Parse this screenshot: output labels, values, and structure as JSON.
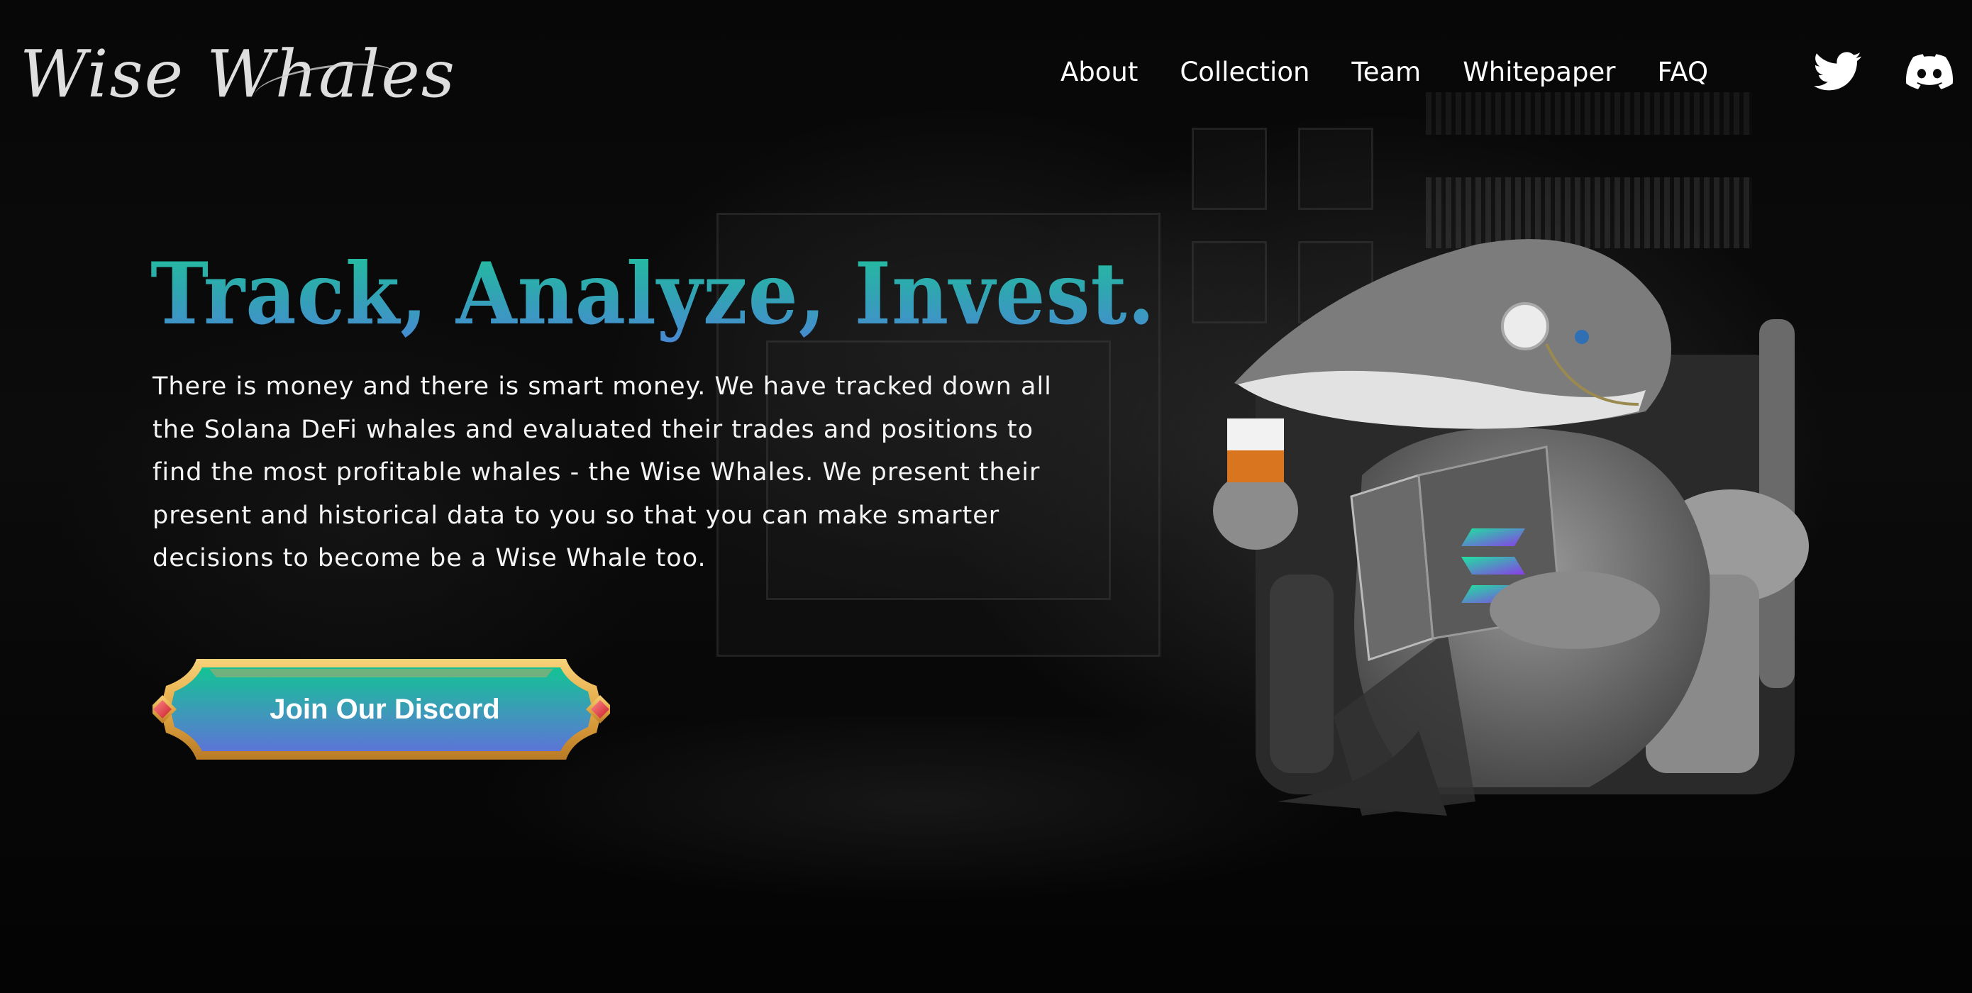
{
  "header": {
    "logo_text": "Wise Whales",
    "nav": [
      {
        "label": "About"
      },
      {
        "label": "Collection"
      },
      {
        "label": "Team"
      },
      {
        "label": "Whitepaper"
      },
      {
        "label": "FAQ"
      }
    ],
    "social": [
      {
        "name": "twitter-icon"
      },
      {
        "name": "discord-icon"
      }
    ]
  },
  "hero": {
    "headline": "Track, Analyze, Invest.",
    "description": "There is money and there is smart money. We have tracked down all the Solana DeFi whales and evaluated their trades and positions to find the most profitable whales - the Wise Whales. We present their present and historical data to you so that you can make smarter decisions to become be a Wise Whale too.",
    "cta_label": "Join Our Discord"
  },
  "colors": {
    "background": "#050505",
    "text": "#ffffff",
    "gradient_top": "#1fc39a",
    "gradient_bottom": "#4a86d6",
    "button_gold": "#e8b04a",
    "button_gem": "#e0323c"
  }
}
